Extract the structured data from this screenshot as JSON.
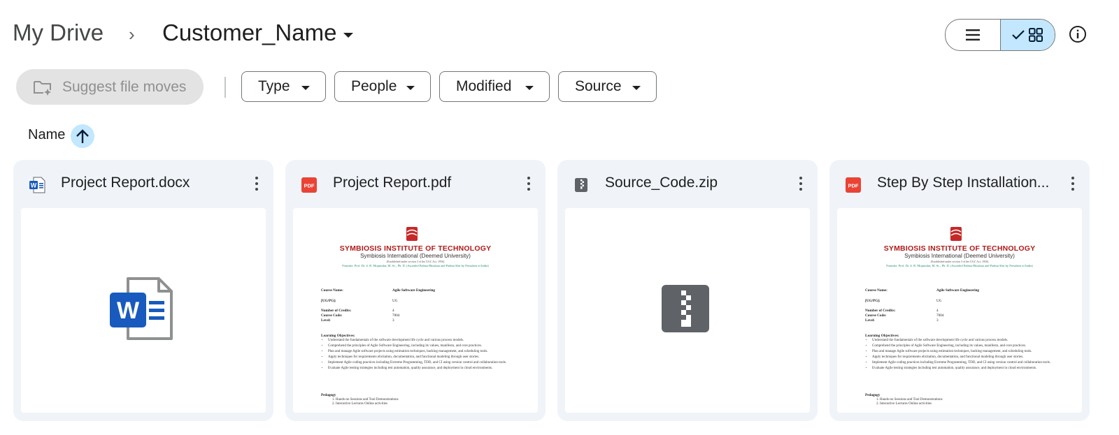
{
  "breadcrumb": {
    "root": "My Drive",
    "separator": "›",
    "current": "Customer_Name"
  },
  "view": {
    "list_icon": "list-icon",
    "grid_icon": "grid-icon",
    "selected": "grid"
  },
  "suggest": {
    "label": "Suggest file moves"
  },
  "filters": [
    {
      "label": "Type"
    },
    {
      "label": "People"
    },
    {
      "label": "Modified"
    },
    {
      "label": "Source"
    }
  ],
  "sort": {
    "label": "Name",
    "direction": "ascending"
  },
  "files": [
    {
      "name": "Project Report.docx",
      "type": "docx",
      "icon": "word-icon"
    },
    {
      "name": "Project Report.pdf",
      "type": "pdf",
      "icon": "pdf-icon"
    },
    {
      "name": "Source_Code.zip",
      "type": "zip",
      "icon": "zip-icon"
    },
    {
      "name": "Step By Step Installation...",
      "type": "pdf",
      "icon": "pdf-icon"
    }
  ],
  "preview": {
    "institute": "SYMBIOSIS  INSTITUTE  OF TECHNOLOGY",
    "university": "Symbiosis International (Deemed University)",
    "established": "(Established under section 3 of the UGC Act, 1956)",
    "founder": "Founder: Prof. Dr. S. B. Mujumdar, M. Sc., Ph. D. (Awarded Padma Bhushan and Padma Shri by President of India)",
    "fields": [
      {
        "key": "Course Name:",
        "value": "Agile Software Engineering"
      },
      {
        "key": "[UG/PG]:",
        "value": "UG"
      },
      {
        "key": "Number of Credits:",
        "value": "4"
      },
      {
        "key": "Course Code:",
        "value": "7004"
      },
      {
        "key": "Level:",
        "value": "3"
      }
    ],
    "objectives_title": "Learning Objectives:",
    "objectives": [
      "Understand the fundamentals of the software development life cycle and various process models.",
      "Comprehend the principles of Agile Software Engineering, including its values, manifesto, and core practices.",
      "Plan and manage Agile software projects using estimation techniques, backlog management, and scheduling tools.",
      "Apply techniques for requirements elicitation, documentation, and functional modeling through user stories.",
      "Implement Agile coding practices including Extreme Programming, TDD, and CI using version control and collaboration tools.",
      "Evaluate Agile testing strategies including test automation, quality assurance, and deployment in cloud environments."
    ],
    "pedagogy_title": "Pedagogy",
    "pedagogy": [
      "1.   Hands-on Sessions and Tool Demonstrations",
      "2.   Interactive Lectures Online activities"
    ]
  },
  "colors": {
    "accent": "#c2e7ff",
    "card_bg": "#f0f4f9",
    "pdf_red": "#ea4335",
    "word_blue": "#185abd",
    "zip_gray": "#5f6368"
  }
}
